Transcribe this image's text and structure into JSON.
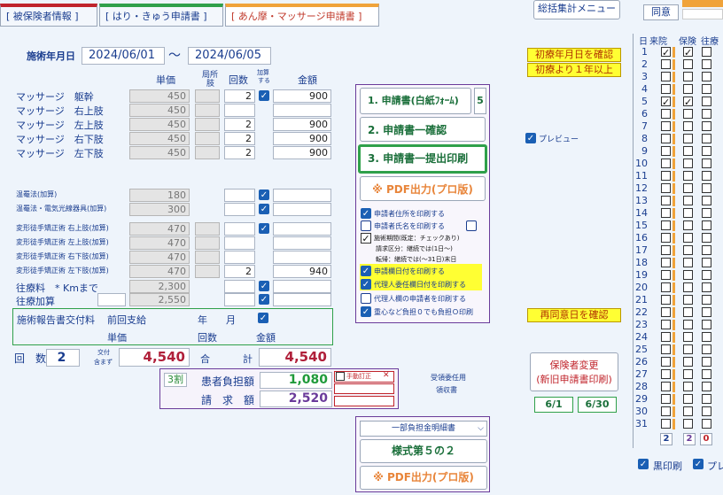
{
  "tabs": [
    {
      "open": "[",
      "label": "被保険者情報",
      "close": "]"
    },
    {
      "open": "[",
      "label": "はり・きゅう申請書",
      "close": "]"
    },
    {
      "open": "[",
      "label": "あん摩・マッサージ申請書",
      "close": "]"
    }
  ],
  "top_menu": {
    "summary_button": "総括集計メニュー",
    "agree_button": "同意"
  },
  "period": {
    "label": "施術年月日",
    "from": "2024/06/01",
    "tilde": "〜",
    "to": "2024/06/05"
  },
  "headers": {
    "price": "単価",
    "part_a": "局所",
    "part_b": "肢",
    "count": "回数",
    "add_a": "加算",
    "add_b": "する",
    "amount": "金額"
  },
  "massage_rows": [
    {
      "label": "マッサージ　躯幹",
      "price": "450",
      "count": "2",
      "checked": true,
      "amount": "900"
    },
    {
      "label": "マッサージ　右上肢",
      "price": "450",
      "count": "",
      "checked": false,
      "amount": ""
    },
    {
      "label": "マッサージ　左上肢",
      "price": "450",
      "count": "2",
      "checked": false,
      "amount": "900"
    },
    {
      "label": "マッサージ　右下肢",
      "price": "450",
      "count": "2",
      "checked": false,
      "amount": "900"
    },
    {
      "label": "マッサージ　左下肢",
      "price": "450",
      "count": "2",
      "checked": false,
      "amount": "900"
    }
  ],
  "heat_rows": [
    {
      "label": "温罨法(加算)",
      "price": "180",
      "checked": true
    },
    {
      "label": "温罨法・電気光線器具(加算)",
      "price": "300",
      "checked": true
    }
  ],
  "deform_rows": [
    {
      "label": "変形徒手矯正術 右上肢(加算)",
      "price": "470",
      "count": "",
      "checked": true,
      "amount": ""
    },
    {
      "label": "変形徒手矯正術 左上肢(加算)",
      "price": "470",
      "count": "",
      "checked": false,
      "amount": ""
    },
    {
      "label": "変形徒手矯正術 右下肢(加算)",
      "price": "470",
      "count": "",
      "checked": false,
      "amount": ""
    },
    {
      "label": "変形徒手矯正術 左下肢(加算)",
      "price": "470",
      "count": "2",
      "checked": false,
      "amount": "940"
    }
  ],
  "visit_fee": {
    "label": "往療料",
    "km_label": "* Kmまで",
    "price": "2,300"
  },
  "visit_add": {
    "label": "往療加算",
    "price": "2,550"
  },
  "report_box": {
    "title": "施術報告書交付料",
    "prev": "前回支給",
    "year": "年",
    "month": "月",
    "unit": "単価",
    "count": "回数",
    "amount": "金額"
  },
  "totals": {
    "count_label": "回　数",
    "count_value": "2",
    "fee_a": "交付",
    "fee_b": "含まず",
    "fee_value": "4,540",
    "total_label_a": "合",
    "total_label_b": "計",
    "total_value": "4,540"
  },
  "burden": {
    "rate": "3割",
    "patient_label": "患者負担額",
    "patient_value": "1,080",
    "bill_label": "請　求　額",
    "bill_value": "2,520",
    "manual_label": "手動訂正",
    "x_mark": "✕"
  },
  "delegate_link": {
    "line1": "受領委任用",
    "line2": "領収書"
  },
  "print_buttons": [
    {
      "label": "1. 申請書(白紙ﾌｫｰﾑ)",
      "badge": "5"
    },
    {
      "label": "2. 申請書一確認"
    },
    {
      "label": "3. 申請書一提出印刷"
    },
    {
      "label": "※ PDF出力(プロ版)"
    }
  ],
  "print_options": [
    {
      "label": "申請者住所を印刷する",
      "checked": true,
      "style": "blue"
    },
    {
      "label": "申請者氏名を印刷する",
      "checked": false,
      "style": "blue"
    },
    {
      "label": "施術期間(既定：チェックあり)",
      "checked": true,
      "style": "black"
    },
    {
      "label": "請求区分：継続では(1日〜)",
      "checked": null,
      "style": "note"
    },
    {
      "label": "転帰：継続では(〜31日)末日",
      "checked": null,
      "style": "note"
    },
    {
      "label": "申請欄日付を印刷する",
      "checked": true,
      "style": "yellow"
    },
    {
      "label": "代理人委任欄日付を印刷する",
      "checked": true,
      "style": "yellow"
    },
    {
      "label": "代理人欄の申請者を印刷する",
      "checked": false,
      "style": "blue"
    },
    {
      "label": "重心など負担０でも負担Ｏ印刷",
      "checked": true,
      "style": "blue"
    }
  ],
  "preview": {
    "label": "プレビュー",
    "checked": true
  },
  "warnings": {
    "first_date": "初療年月日を確認",
    "over_year": "初療より１年以上",
    "reconsent": "再同意日を確認"
  },
  "insurer_change": {
    "line1": "保険者変更",
    "line2": "(新旧申請書印刷)"
  },
  "date_buttons": [
    "6/1",
    "6/30"
  ],
  "bottom": {
    "dropdown": "一部負担金明細書",
    "form5": "様式第５の２",
    "pdf": "※ PDF出力(プロ版)"
  },
  "calendar": {
    "headers": [
      "日",
      "来院",
      "保険",
      "往療"
    ],
    "visited": [
      1,
      5
    ],
    "insured": [
      1,
      5
    ],
    "totals": [
      "2",
      "2",
      "0"
    ]
  },
  "bottom_right": {
    "black_print": "黒印刷",
    "preview_short": "プレ"
  }
}
